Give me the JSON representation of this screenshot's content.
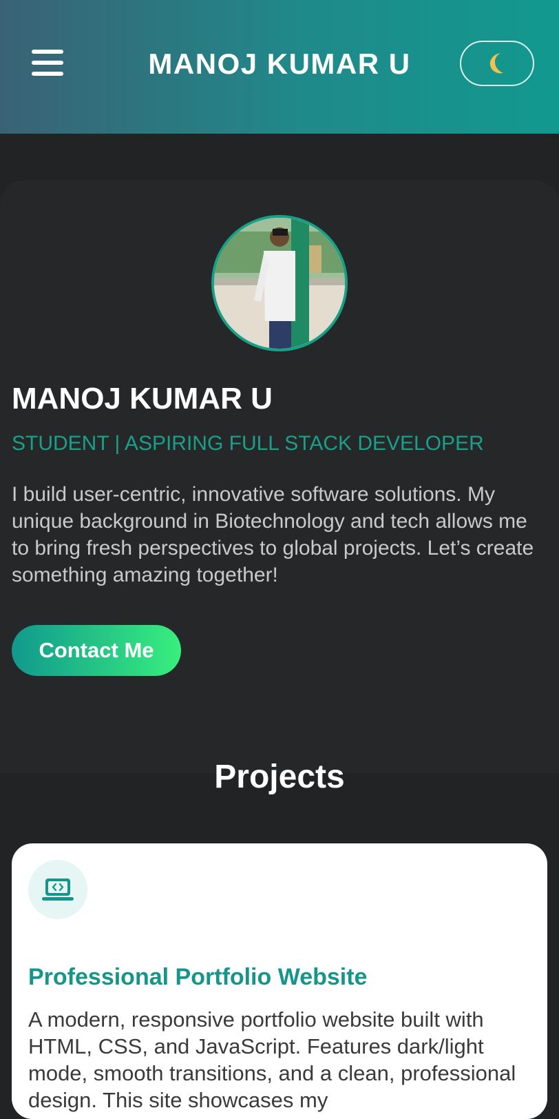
{
  "header": {
    "menu_icon": "hamburger-menu-icon",
    "title": "MANOJ KUMAR U",
    "theme_toggle_icon": "moon-icon",
    "colors": {
      "gradient_start": "#3a6275",
      "gradient_end": "#11998e"
    }
  },
  "hero": {
    "avatar_icon": "profile-photo",
    "name": "MANOJ KUMAR U",
    "role": "STUDENT | ASPIRING FULL STACK DEVELOPER",
    "bio": "I build user-centric, innovative software solutions. My unique background in Biotechnology and tech allows me to bring fresh perspectives to global projects. Let’s create something amazing together!",
    "contact_button": "Contact Me",
    "colors": {
      "accent": "#16a085",
      "button_gradient_start": "#11998e",
      "button_gradient_end": "#38ef7d",
      "background": "#262729"
    }
  },
  "projects": {
    "section_title": "Projects",
    "items": [
      {
        "icon": "laptop-code-icon",
        "title": "Professional Portfolio Website",
        "description": "A modern, responsive portfolio website built with HTML, CSS, and JavaScript. Features dark/light mode, smooth transitions, and a clean, professional design. This site showcases my"
      }
    ]
  }
}
